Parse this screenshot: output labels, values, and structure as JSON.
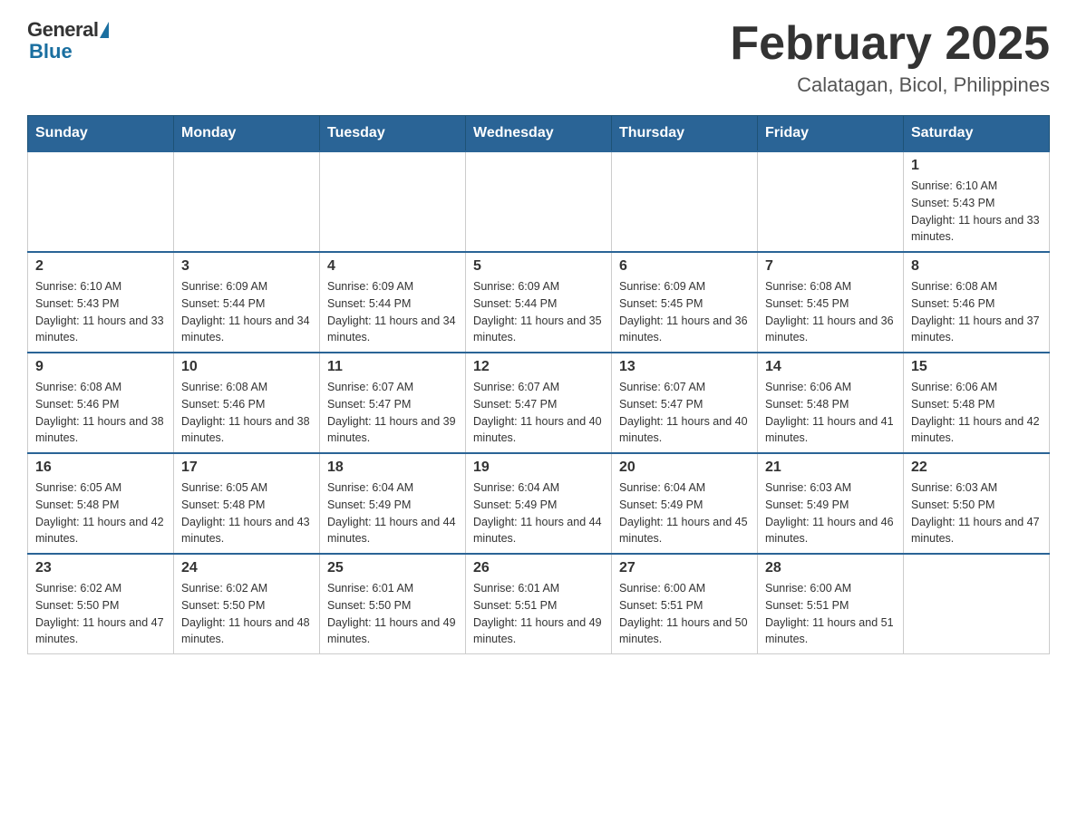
{
  "logo": {
    "general": "General",
    "blue": "Blue"
  },
  "title": {
    "month_year": "February 2025",
    "location": "Calatagan, Bicol, Philippines"
  },
  "weekdays": [
    "Sunday",
    "Monday",
    "Tuesday",
    "Wednesday",
    "Thursday",
    "Friday",
    "Saturday"
  ],
  "weeks": [
    [
      {
        "day": "",
        "info": ""
      },
      {
        "day": "",
        "info": ""
      },
      {
        "day": "",
        "info": ""
      },
      {
        "day": "",
        "info": ""
      },
      {
        "day": "",
        "info": ""
      },
      {
        "day": "",
        "info": ""
      },
      {
        "day": "1",
        "info": "Sunrise: 6:10 AM\nSunset: 5:43 PM\nDaylight: 11 hours and 33 minutes."
      }
    ],
    [
      {
        "day": "2",
        "info": "Sunrise: 6:10 AM\nSunset: 5:43 PM\nDaylight: 11 hours and 33 minutes."
      },
      {
        "day": "3",
        "info": "Sunrise: 6:09 AM\nSunset: 5:44 PM\nDaylight: 11 hours and 34 minutes."
      },
      {
        "day": "4",
        "info": "Sunrise: 6:09 AM\nSunset: 5:44 PM\nDaylight: 11 hours and 34 minutes."
      },
      {
        "day": "5",
        "info": "Sunrise: 6:09 AM\nSunset: 5:44 PM\nDaylight: 11 hours and 35 minutes."
      },
      {
        "day": "6",
        "info": "Sunrise: 6:09 AM\nSunset: 5:45 PM\nDaylight: 11 hours and 36 minutes."
      },
      {
        "day": "7",
        "info": "Sunrise: 6:08 AM\nSunset: 5:45 PM\nDaylight: 11 hours and 36 minutes."
      },
      {
        "day": "8",
        "info": "Sunrise: 6:08 AM\nSunset: 5:46 PM\nDaylight: 11 hours and 37 minutes."
      }
    ],
    [
      {
        "day": "9",
        "info": "Sunrise: 6:08 AM\nSunset: 5:46 PM\nDaylight: 11 hours and 38 minutes."
      },
      {
        "day": "10",
        "info": "Sunrise: 6:08 AM\nSunset: 5:46 PM\nDaylight: 11 hours and 38 minutes."
      },
      {
        "day": "11",
        "info": "Sunrise: 6:07 AM\nSunset: 5:47 PM\nDaylight: 11 hours and 39 minutes."
      },
      {
        "day": "12",
        "info": "Sunrise: 6:07 AM\nSunset: 5:47 PM\nDaylight: 11 hours and 40 minutes."
      },
      {
        "day": "13",
        "info": "Sunrise: 6:07 AM\nSunset: 5:47 PM\nDaylight: 11 hours and 40 minutes."
      },
      {
        "day": "14",
        "info": "Sunrise: 6:06 AM\nSunset: 5:48 PM\nDaylight: 11 hours and 41 minutes."
      },
      {
        "day": "15",
        "info": "Sunrise: 6:06 AM\nSunset: 5:48 PM\nDaylight: 11 hours and 42 minutes."
      }
    ],
    [
      {
        "day": "16",
        "info": "Sunrise: 6:05 AM\nSunset: 5:48 PM\nDaylight: 11 hours and 42 minutes."
      },
      {
        "day": "17",
        "info": "Sunrise: 6:05 AM\nSunset: 5:48 PM\nDaylight: 11 hours and 43 minutes."
      },
      {
        "day": "18",
        "info": "Sunrise: 6:04 AM\nSunset: 5:49 PM\nDaylight: 11 hours and 44 minutes."
      },
      {
        "day": "19",
        "info": "Sunrise: 6:04 AM\nSunset: 5:49 PM\nDaylight: 11 hours and 44 minutes."
      },
      {
        "day": "20",
        "info": "Sunrise: 6:04 AM\nSunset: 5:49 PM\nDaylight: 11 hours and 45 minutes."
      },
      {
        "day": "21",
        "info": "Sunrise: 6:03 AM\nSunset: 5:49 PM\nDaylight: 11 hours and 46 minutes."
      },
      {
        "day": "22",
        "info": "Sunrise: 6:03 AM\nSunset: 5:50 PM\nDaylight: 11 hours and 47 minutes."
      }
    ],
    [
      {
        "day": "23",
        "info": "Sunrise: 6:02 AM\nSunset: 5:50 PM\nDaylight: 11 hours and 47 minutes."
      },
      {
        "day": "24",
        "info": "Sunrise: 6:02 AM\nSunset: 5:50 PM\nDaylight: 11 hours and 48 minutes."
      },
      {
        "day": "25",
        "info": "Sunrise: 6:01 AM\nSunset: 5:50 PM\nDaylight: 11 hours and 49 minutes."
      },
      {
        "day": "26",
        "info": "Sunrise: 6:01 AM\nSunset: 5:51 PM\nDaylight: 11 hours and 49 minutes."
      },
      {
        "day": "27",
        "info": "Sunrise: 6:00 AM\nSunset: 5:51 PM\nDaylight: 11 hours and 50 minutes."
      },
      {
        "day": "28",
        "info": "Sunrise: 6:00 AM\nSunset: 5:51 PM\nDaylight: 11 hours and 51 minutes."
      },
      {
        "day": "",
        "info": ""
      }
    ]
  ]
}
